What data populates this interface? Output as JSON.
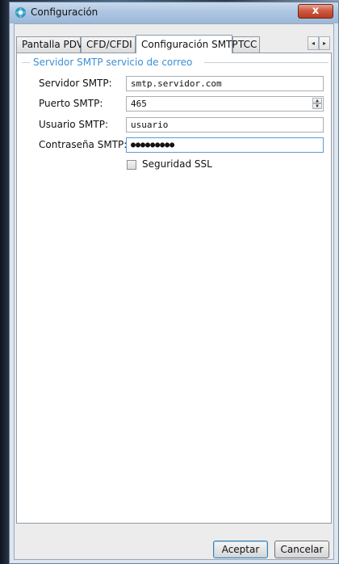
{
  "window": {
    "title": "Configuración",
    "close_label": "x"
  },
  "tabs": [
    {
      "label": "Pantalla PDV"
    },
    {
      "label": "CFD/CFDI"
    },
    {
      "label": "Configuración SMTP"
    },
    {
      "label": "TCC"
    }
  ],
  "tab_scroll": {
    "left": "◂",
    "right": "▸"
  },
  "smtp": {
    "group_title": "Servidor SMTP servicio de correo",
    "server_label": "Servidor SMTP:",
    "server_value": "smtp.servidor.com",
    "port_label": "Puerto SMTP:",
    "port_value": "465",
    "user_label": "Usuario SMTP:",
    "user_value": "usuario",
    "password_label": "Contraseña SMTP:",
    "password_value": "●●●●●●●●●",
    "ssl_label": "Seguridad SSL",
    "ssl_checked": false
  },
  "buttons": {
    "accept": "Aceptar",
    "cancel": "Cancelar"
  },
  "colors": {
    "accent": "#3b8fd6",
    "titlebar": "#aec6e2",
    "close": "#cf5b43"
  }
}
